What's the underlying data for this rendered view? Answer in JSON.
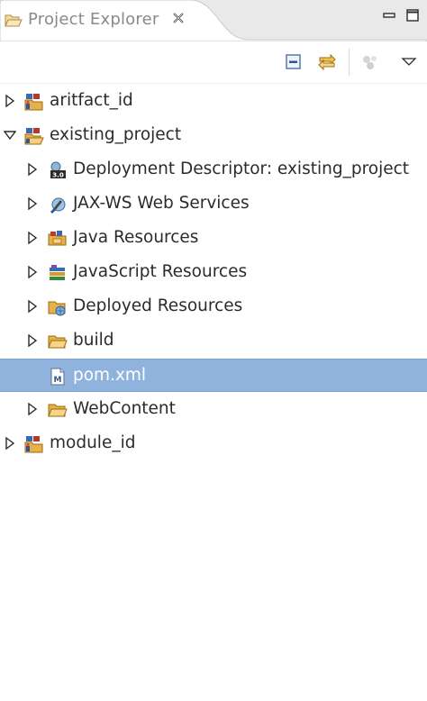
{
  "panel": {
    "title": "Project Explorer",
    "icon": "project-explorer-folder-icon"
  },
  "window_controls": {
    "minimize": "minimize-icon",
    "maximize": "maximize-icon"
  },
  "toolbar": {
    "collapse_all": "collapse-all-icon",
    "link_with_editor": "link-with-editor-icon",
    "filters": "filters-icon",
    "view_menu": "view-menu-icon"
  },
  "tree": {
    "items": [
      {
        "label": "aritfact_id",
        "level": 0,
        "expanded": false,
        "icon": "maven-project-icon",
        "selected": false
      },
      {
        "label": "existing_project",
        "level": 0,
        "expanded": true,
        "icon": "maven-project-open-icon",
        "selected": false
      },
      {
        "label": "Deployment Descriptor: existing_project",
        "level": 1,
        "expanded": false,
        "icon": "deployment-descriptor-icon",
        "selected": false
      },
      {
        "label": "JAX-WS Web Services",
        "level": 1,
        "expanded": false,
        "icon": "web-services-icon",
        "selected": false
      },
      {
        "label": "Java Resources",
        "level": 1,
        "expanded": false,
        "icon": "java-resources-icon",
        "selected": false
      },
      {
        "label": "JavaScript Resources",
        "level": 1,
        "expanded": false,
        "icon": "javascript-resources-icon",
        "selected": false
      },
      {
        "label": "Deployed Resources",
        "level": 1,
        "expanded": false,
        "icon": "deployed-resources-icon",
        "selected": false
      },
      {
        "label": "build",
        "level": 1,
        "expanded": false,
        "icon": "folder-icon",
        "selected": false
      },
      {
        "label": "pom.xml",
        "level": 1,
        "expanded": null,
        "icon": "maven-pom-file-icon",
        "selected": true
      },
      {
        "label": "WebContent",
        "level": 1,
        "expanded": false,
        "icon": "folder-icon",
        "selected": false
      },
      {
        "label": "module_id",
        "level": 0,
        "expanded": false,
        "icon": "maven-project-icon",
        "selected": false
      }
    ]
  },
  "colors": {
    "selection": "#8fb3dc",
    "tab_background": "#e9e9e9",
    "folder": "#e8b04a"
  }
}
